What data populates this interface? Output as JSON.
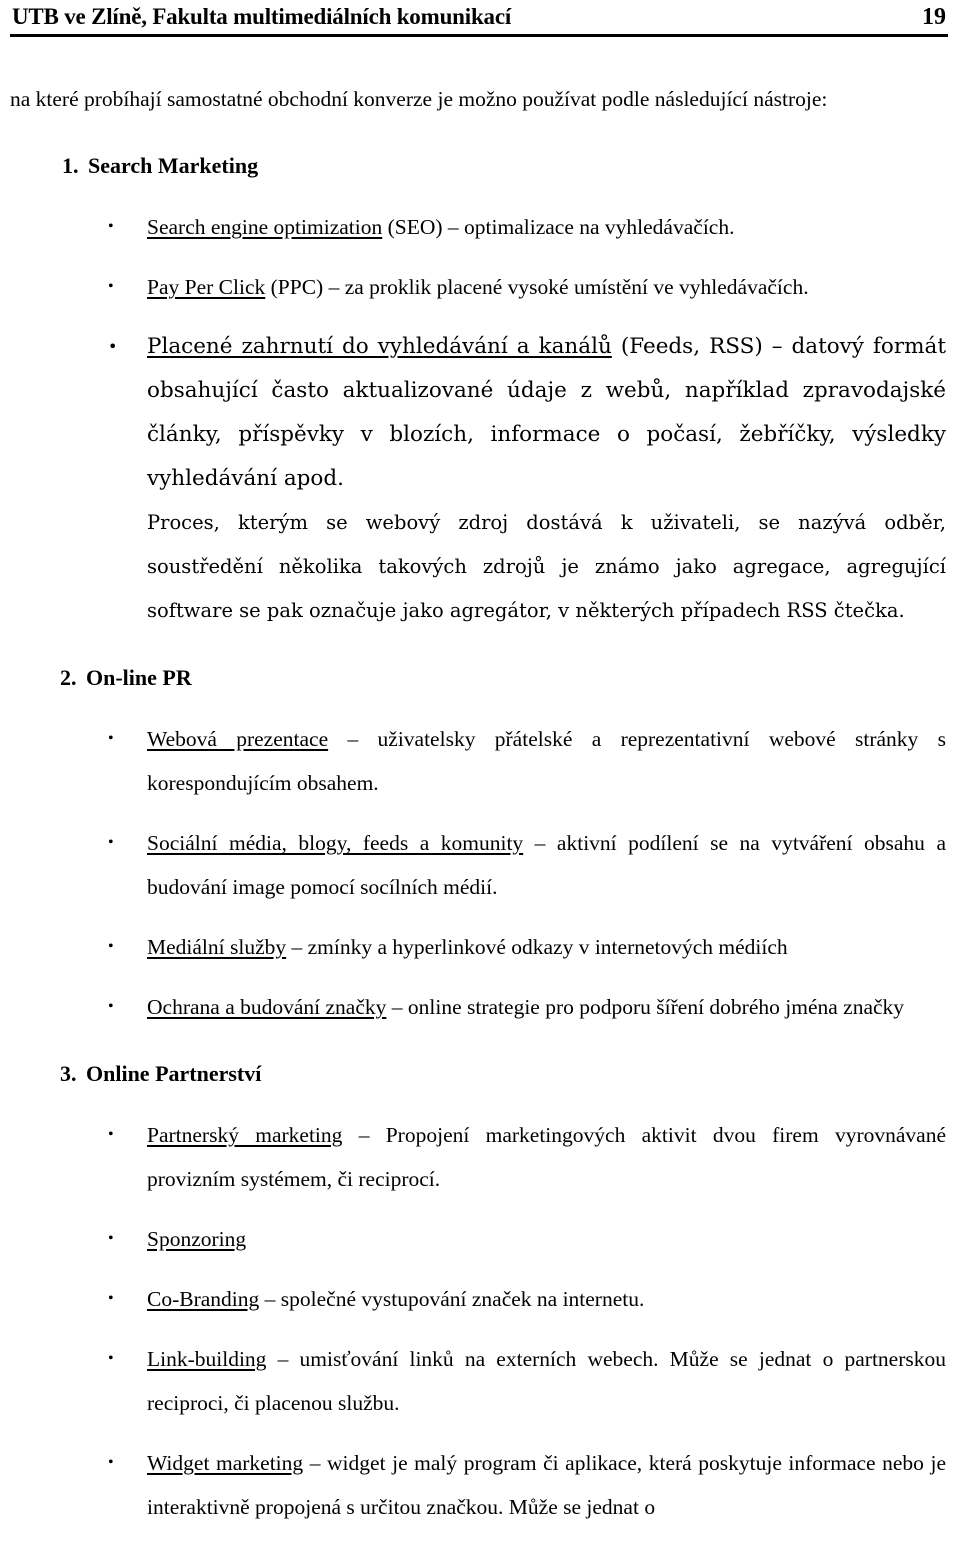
{
  "header": {
    "title": "UTB ve Zlíně, Fakulta multimediálních komunikací",
    "page_number": "19"
  },
  "intro": "na které probíhají samostatné obchodní konverze je možno používat podle následující nástroje:",
  "sections": [
    {
      "number": "1.",
      "title": "Search Marketing",
      "bullets": [
        {
          "term": "Search engine optimization",
          "rest": " (SEO) – optimalizace na vyhledávačích."
        },
        {
          "term": "Pay Per Click",
          "rest": " (PPC) – za proklik placené vysoké umístění ve vyhledávačích."
        },
        {
          "term": "Placené zahrnutí do vyhledávání a kanálů",
          "rest": " (Feeds, RSS) – datový formát obsahující často aktualizované údaje z webů, například zpravodajské články, příspěvky v blozích, informace o počasí, žebříčky, výsledky vyhledávání apod.",
          "extra": "Proces, kterým se webový zdroj dostává k uživateli, se nazývá odběr, soustředění několika takových zdrojů je známo jako agregace, agregující software se pak označuje jako agregátor, v některých případech RSS čtečka."
        }
      ]
    },
    {
      "number": "2.",
      "title": "On-line PR",
      "bullets": [
        {
          "term": "Webová prezentace",
          "rest": " – uživatelsky přátelské a reprezentativní webové stránky s korespondujícím obsahem."
        },
        {
          "term": "Sociální média, blogy, feeds a komunity",
          "rest": " – aktivní podílení se na vytváření obsahu a budování image pomocí socílních médií."
        },
        {
          "term": "Mediální služby",
          "rest": " – zmínky a hyperlinkové odkazy v internetových médiích"
        },
        {
          "term": "Ochrana a budování značky",
          "rest": " – online strategie pro podporu šíření dobrého jména značky"
        }
      ]
    },
    {
      "number": "3.",
      "title": "Online Partnerství",
      "bullets": [
        {
          "term": "Partnerský marketing",
          "rest": " – Propojení marketingových aktivit dvou firem vyrovnávané provizním systémem, či reciprocí."
        },
        {
          "term": "Sponzoring",
          "rest": ""
        },
        {
          "term": "Co-Branding",
          "rest": " – společné vystupování značek na internetu."
        },
        {
          "term": "Link-building",
          "rest": " – umisťování linků na externích webech. Může se jednat o partnerskou reciproci, či placenou službu."
        },
        {
          "term": "Widget marketing",
          "rest": " – widget je malý program či aplikace, která poskytuje informace nebo je interaktivně propojená s určitou značkou. Může se jednat o"
        }
      ]
    }
  ]
}
